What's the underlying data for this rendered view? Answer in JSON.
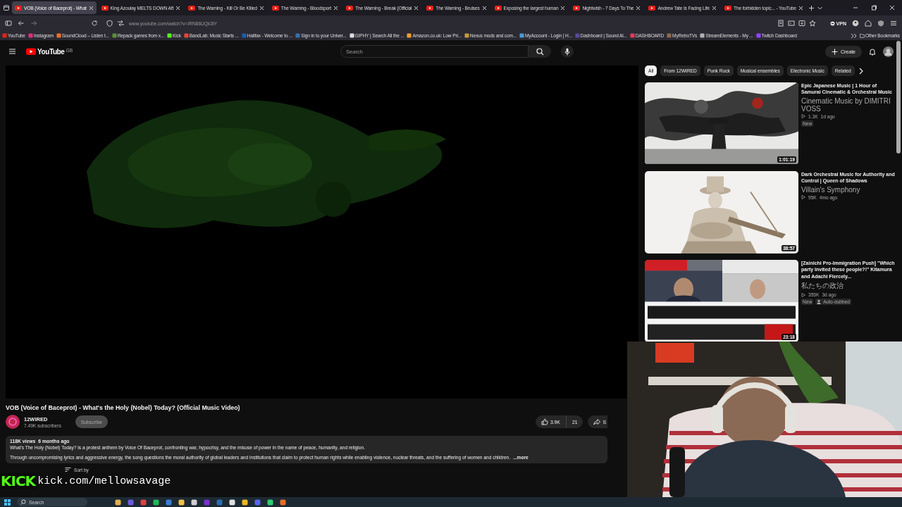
{
  "browser": {
    "tabs": [
      {
        "title": "VOB (Voice of Baceprot) - What",
        "selected": true
      },
      {
        "title": "King Azoulay MELTS DOWN Aft",
        "selected": false
      },
      {
        "title": "The Warning - Kill Or Be Killed",
        "selected": false
      },
      {
        "title": "The Warning - Bloodsport",
        "selected": false
      },
      {
        "title": "The Warning - Break (Official",
        "selected": false
      },
      {
        "title": "The Warning - Bruises",
        "selected": false
      },
      {
        "title": "Exposing the largest human",
        "selected": false
      },
      {
        "title": "Nightwish - 7 Days To The",
        "selected": false
      },
      {
        "title": "Andrew Tate Is Facing Life",
        "selected": false
      },
      {
        "title": "The forbidden topic... - YouTube",
        "selected": false
      }
    ],
    "url": "www.youtube.com/watch?v=IRN86UQk3tY",
    "vpn_label": "VPN",
    "bookmarks": [
      "YouTube",
      "Instagram",
      "SoundCloud – Listen t...",
      "Repack games from x...",
      "Kick",
      "BandLab: Music Starts ...",
      "Halifax - Welcome to ...",
      "Sign in to your Univer...",
      "GIPHY | Search All the ...",
      "Amazon.co.uk: Low Pri...",
      "Nexus mods and com...",
      "MyAccount - Login | H...",
      "Dashboard | Sound Al...",
      "DASHBOARD",
      "MyRetroTVs",
      "StreamElements - My ...",
      "Twitch Dashboard"
    ],
    "other_bookmarks": "Other Bookmarks"
  },
  "youtube": {
    "logo": "YouTube",
    "region": "GB",
    "search_placeholder": "Search",
    "create_label": "Create",
    "chips": [
      {
        "label": "All",
        "selected": true
      },
      {
        "label": "From 12WIRED",
        "selected": false
      },
      {
        "label": "Punk Rock",
        "selected": false
      },
      {
        "label": "Musical ensembles",
        "selected": false
      },
      {
        "label": "Electronic Music",
        "selected": false
      },
      {
        "label": "Related",
        "selected": false
      }
    ],
    "video": {
      "title": "VOB (Voice of Baceprot) - What's the Holy (Nobel) Today? (Official Music Video)",
      "channel": "12WIRED",
      "subscribers": "7.49K subscribers",
      "subscribe_label": "Subscribe",
      "likes": "3.9K",
      "dislikes": "21",
      "share_label": "S",
      "views": "118K views",
      "age": "6 months ago",
      "paragraphs": [
        "What's The Holy (Nobel) Today? is a protest anthem by Voice Of Baceprot, confronting war, hypocrisy, and the misuse of power in the name of peace, humanity, and religion.",
        "Through uncompromising lyrics and aggressive energy, the song questions the moral authority of global leaders and institutions that claim to protect human rights while enabling violence, nuclear threats, and the suffering of women and children."
      ],
      "more_label": "...more",
      "sort_label": "Sort by"
    },
    "sidebar": [
      {
        "title": "Epic Japanese Music | 1 Hour of Samurai Cinematic & Orchestral Music",
        "channel": "Cinematic Music by DIMITRI VOSS",
        "views": "1.3K",
        "age": "1d ago",
        "duration": "1:01:19",
        "badges": [
          {
            "kind": "new",
            "label": "New"
          }
        ]
      },
      {
        "title": "Dark Orchestral Music for Authority and Control | Queen of Shadows",
        "channel": "Villain's Symphony",
        "views": "95K",
        "age": "4mo ago",
        "duration": "38:57"
      },
      {
        "title": "[Zainichi Pro-Immigration Push] \"Which party invited these people?!\" Kitamura and Adachi Fiercely...",
        "channel": "私たちの政治",
        "views": "355K",
        "age": "3d ago",
        "duration": "23:18",
        "badges": [
          {
            "kind": "new",
            "label": "New"
          },
          {
            "kind": "dubbed",
            "label": "Auto-dubbed"
          }
        ]
      }
    ]
  },
  "overlay": {
    "logo": "KICK",
    "url": "kick.com/mellowsavage"
  },
  "taskbar": {
    "search_placeholder": "Search"
  }
}
